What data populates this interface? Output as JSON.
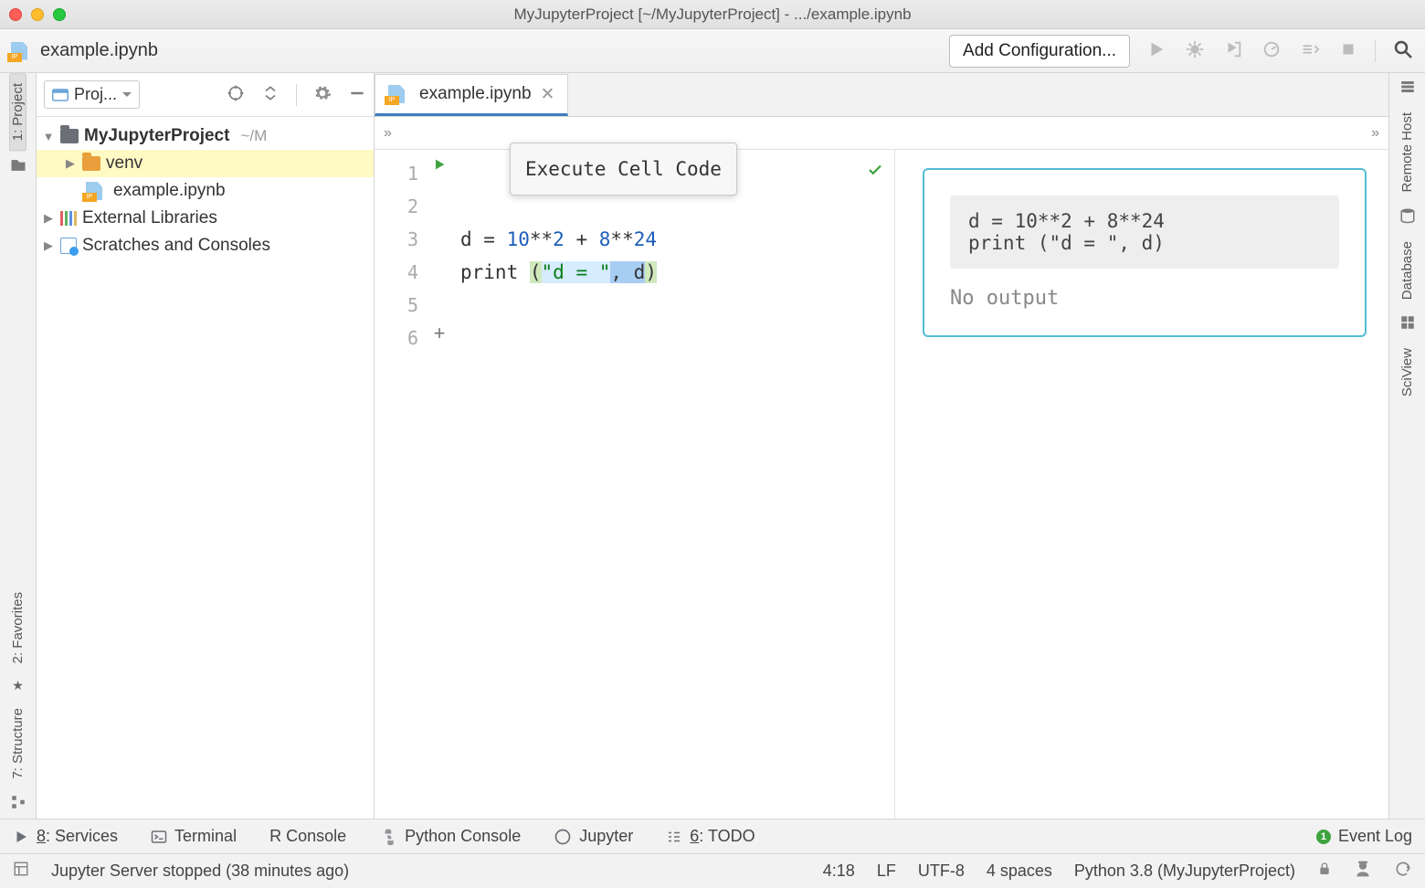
{
  "window_title": "MyJupyterProject [~/MyJupyterProject] - .../example.ipynb",
  "topbar": {
    "filename": "example.ipynb",
    "add_config": "Add Configuration..."
  },
  "left_tools": {
    "project": "1: Project",
    "favorites": "2: Favorites",
    "structure": "7: Structure"
  },
  "right_tools": {
    "remote": "Remote Host",
    "database": "Database",
    "sciview": "SciView"
  },
  "project_panel": {
    "header": "Proj...",
    "root_name": "MyJupyterProject",
    "root_path": "~/M",
    "venv": "venv",
    "file": "example.ipynb",
    "ext_libs": "External Libraries",
    "scratches": "Scratches and Consoles"
  },
  "editor": {
    "tab": "example.ipynb",
    "crumb_left": "»",
    "crumb_right": "»",
    "tooltip": "Execute Cell Code",
    "line_numbers": [
      "1",
      "2",
      "3",
      "4",
      "5",
      "6"
    ],
    "code": {
      "line3": {
        "pre": "d = ",
        "n1": "10",
        "op1": "**",
        "n2": "2",
        "plus": " + ",
        "n3": "8",
        "op2": "**",
        "n4": "24"
      },
      "line4": {
        "fn": "print ",
        "lpar": "(",
        "str": "\"d = \"",
        "comma": ", d",
        "rpar": ")"
      }
    }
  },
  "preview": {
    "code_text": "d = 10**2 + 8**24\nprint (\"d = \", d)",
    "no_output": "No output"
  },
  "bottom_tools": {
    "services": "8: Services",
    "terminal": "Terminal",
    "rconsole": "R Console",
    "pyconsole": "Python Console",
    "jupyter": "Jupyter",
    "todo": "6: TODO",
    "eventlog": "Event Log",
    "eventcount": "1"
  },
  "status": {
    "message": "Jupyter Server stopped (38 minutes ago)",
    "cursor": "4:18",
    "eol": "LF",
    "encoding": "UTF-8",
    "spaces": "4 spaces",
    "interpreter": "Python 3.8 (MyJupyterProject)"
  }
}
